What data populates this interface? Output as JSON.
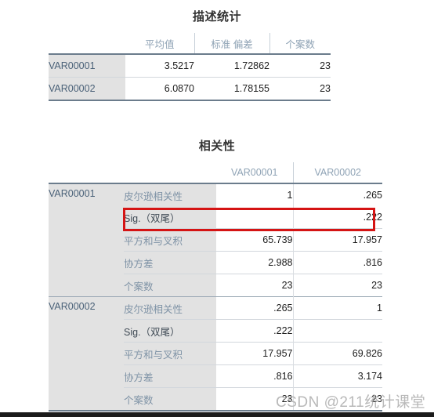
{
  "descriptive": {
    "title": "描述统计",
    "column_headers": [
      "",
      "平均值",
      "标准 偏差",
      "个案数"
    ],
    "rows": [
      {
        "label": "VAR00001",
        "mean": "3.5217",
        "sd": "1.72862",
        "n": "23"
      },
      {
        "label": "VAR00002",
        "mean": "6.0870",
        "sd": "1.78155",
        "n": "23"
      }
    ]
  },
  "correlations": {
    "title": "相关性",
    "column_headers": [
      "",
      "",
      "VAR00001",
      "VAR00002"
    ],
    "blocks": [
      {
        "variable": "VAR00001",
        "stats": [
          {
            "label": "皮尔逊相关性",
            "var1": "1",
            "var2": ".265"
          },
          {
            "label": "Sig.（双尾）",
            "var1": "",
            "var2": ".222",
            "highlighted": true
          },
          {
            "label": "平方和与叉积",
            "var1": "65.739",
            "var2": "17.957"
          },
          {
            "label": "协方差",
            "var1": "2.988",
            "var2": ".816"
          },
          {
            "label": "个案数",
            "var1": "23",
            "var2": "23"
          }
        ]
      },
      {
        "variable": "VAR00002",
        "stats": [
          {
            "label": "皮尔逊相关性",
            "var1": ".265",
            "var2": "1"
          },
          {
            "label": "Sig.（双尾）",
            "var1": ".222",
            "var2": ""
          },
          {
            "label": "平方和与叉积",
            "var1": "17.957",
            "var2": "69.826"
          },
          {
            "label": "协方差",
            "var1": ".816",
            "var2": "3.174"
          },
          {
            "label": "个案数",
            "var1": "23",
            "var2": "23"
          }
        ]
      }
    ]
  },
  "annotation": {
    "highlight_color": "#d51414",
    "highlight_target": "Sig.（双尾） = .222"
  },
  "watermark": {
    "text": "CSDN @211统计课堂"
  }
}
